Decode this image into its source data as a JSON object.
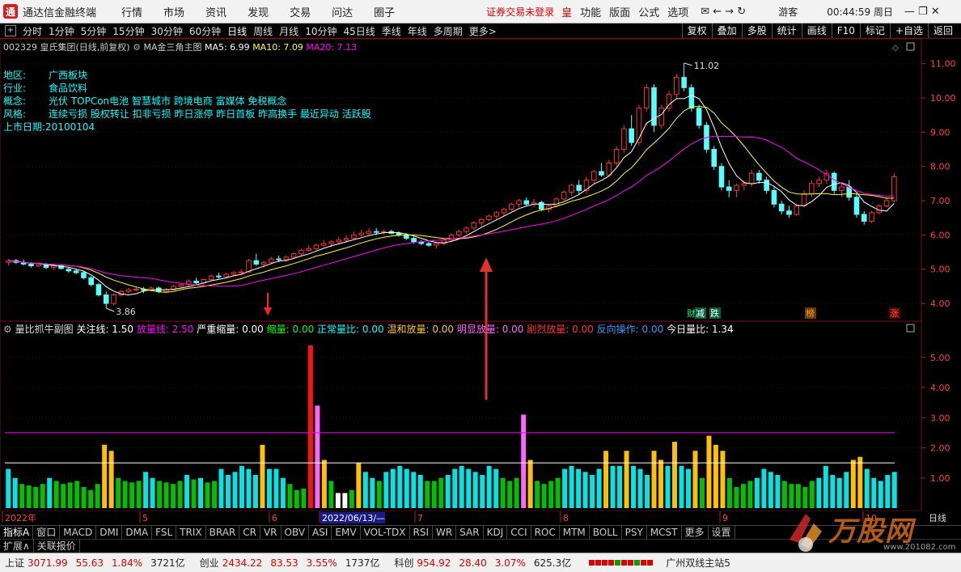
{
  "menubar": {
    "logo": "通",
    "app_title": "通达信金融终端",
    "menus": [
      "行情",
      "市场",
      "资讯",
      "发现",
      "交易",
      "问达",
      "圈子"
    ],
    "warning": "证券交易未登录",
    "right_items": [
      "皇",
      "功能",
      "版面",
      "公式",
      "选项"
    ],
    "tool_icons": "✉ ← → ↻",
    "guest": "游客",
    "clock": "00:44:59 周日",
    "window_buttons": "— ❐ ✕"
  },
  "periodbar": {
    "periods": [
      "分时",
      "1分钟",
      "5分钟",
      "15分钟",
      "30分钟",
      "60分钟",
      "日线",
      "周线",
      "月线",
      "10分钟",
      "45日线",
      "季线",
      "年线",
      "多周期",
      "更多>"
    ],
    "active": "日线",
    "right_buttons": [
      "复权",
      "叠加",
      "多股",
      "统计",
      "画线",
      "F10",
      "标记",
      "+自选",
      "返回"
    ]
  },
  "main_header": {
    "stock": "002329 皇氏集团(日线,前复权)",
    "indicator": "MA金三角主图",
    "ma5": "MA5: 6.99",
    "ma10": "MA10: 7.09",
    "ma20": "MA20: 7.13"
  },
  "info": [
    {
      "key": "地区:",
      "value": "广西板块"
    },
    {
      "key": "行业:",
      "value": "食品饮料"
    },
    {
      "key": "概念:",
      "value": "光伏 TOPCon电池 智慧城市 跨境电商 富媒体 免税概念"
    },
    {
      "key": "风格:",
      "value": "连续亏损 股权转让 扣非亏损 昨日涨停 昨日首板 昨高换手 最近异动 活跃股"
    },
    {
      "key": "上市日期:",
      "value": "20100104"
    }
  ],
  "price_axis": [
    "11.00",
    "10.00",
    "9.00",
    "8.00",
    "7.00",
    "6.00",
    "5.00",
    "4.00"
  ],
  "annotations": {
    "high": "11.02",
    "low": "3.86",
    "badges": [
      "减",
      "跌",
      "榜",
      "涨"
    ],
    "badge_prefix": "财"
  },
  "sub_header": {
    "name": "量比抓牛副图",
    "items": [
      {
        "label": "关注线: 1.50",
        "color": "#ffffff"
      },
      {
        "label": "放量线: 2.50",
        "color": "#ff00ff"
      },
      {
        "label": "严重缩量: 0.00",
        "color": "#ffffff"
      },
      {
        "label": "缩量: 0.00",
        "color": "#00ff00"
      },
      {
        "label": "正常量比: 0.00",
        "color": "#00ffff"
      },
      {
        "label": "温和放量: 0.00",
        "color": "#ffcc00"
      },
      {
        "label": "明显放量: 0.00",
        "color": "#ff66ff"
      },
      {
        "label": "剧烈放量: 0.00",
        "color": "#ff3333"
      },
      {
        "label": "反向操作: 0.00",
        "color": "#3399ff"
      },
      {
        "label": "今日量比: 1.34",
        "color": "#ffffff"
      }
    ]
  },
  "sub_axis": [
    "5.00",
    "4.00",
    "3.00",
    "2.00",
    "1.00"
  ],
  "time_axis": {
    "labels": [
      "2022年",
      "5",
      "6",
      "2022/06/13/—",
      "7",
      "8",
      "9",
      "10"
    ],
    "period": "日线"
  },
  "indicators": [
    "指标A",
    "窗口",
    "MACD",
    "DMI",
    "DMA",
    "FSL",
    "TRIX",
    "BRAR",
    "CR",
    "VR",
    "OBV",
    "ASI",
    "EMV",
    "VOL-TDX",
    "RSI",
    "WR",
    "SAR",
    "KDJ",
    "CCI",
    "ROC",
    "MTM",
    "BOLL",
    "PSY",
    "MCST",
    "更多",
    "设置"
  ],
  "ext_bar": [
    "扩展∧",
    "关联报价"
  ],
  "status": {
    "sh": {
      "name": "上证",
      "price": "3071.99",
      "chg": "55.63",
      "pct": "1.84%",
      "amt": "3721亿"
    },
    "cy": {
      "name": "创业",
      "price": "2434.22",
      "chg": "83.53",
      "pct": "3.55%",
      "amt": "1737亿"
    },
    "kc": {
      "name": "科创",
      "price": "954.92",
      "chg": "28.40",
      "pct": "3.07%",
      "amt": "625.3亿"
    },
    "server": "广州双线主站5"
  },
  "watermark": {
    "text": "万股网",
    "url": "www.201082.com"
  },
  "chart_data": {
    "type": "candlestick",
    "title": "002329 皇氏集团(日线,前复权)",
    "ylim": [
      3.6,
      11.3
    ],
    "price_ticks": [
      4,
      5,
      6,
      7,
      8,
      9,
      10,
      11
    ],
    "ohlc": [
      [
        5.2,
        5.3,
        5.1,
        5.25
      ],
      [
        5.25,
        5.3,
        5.15,
        5.2
      ],
      [
        5.2,
        5.28,
        5.1,
        5.15
      ],
      [
        5.15,
        5.2,
        5.05,
        5.1
      ],
      [
        5.1,
        5.2,
        5.05,
        5.15
      ],
      [
        5.15,
        5.18,
        5.0,
        5.05
      ],
      [
        5.05,
        5.12,
        4.98,
        5.1
      ],
      [
        5.1,
        5.14,
        5.0,
        5.02
      ],
      [
        5.0,
        5.05,
        4.9,
        4.95
      ],
      [
        4.95,
        5.0,
        4.85,
        4.9
      ],
      [
        4.9,
        4.95,
        4.7,
        4.75
      ],
      [
        4.75,
        4.8,
        4.5,
        4.55
      ],
      [
        4.55,
        4.6,
        4.2,
        4.25
      ],
      [
        4.25,
        4.35,
        3.86,
        4.0
      ],
      [
        4.0,
        4.3,
        3.95,
        4.25
      ],
      [
        4.25,
        4.4,
        4.2,
        4.35
      ],
      [
        4.35,
        4.45,
        4.3,
        4.4
      ],
      [
        4.4,
        4.5,
        4.35,
        4.42
      ],
      [
        4.42,
        4.48,
        4.3,
        4.38
      ],
      [
        4.38,
        4.5,
        4.35,
        4.45
      ],
      [
        4.45,
        4.5,
        4.3,
        4.35
      ],
      [
        4.35,
        4.45,
        4.3,
        4.4
      ],
      [
        4.4,
        4.55,
        4.38,
        4.5
      ],
      [
        4.5,
        4.6,
        4.45,
        4.55
      ],
      [
        4.55,
        4.7,
        4.5,
        4.65
      ],
      [
        4.65,
        4.75,
        4.55,
        4.6
      ],
      [
        4.6,
        4.72,
        4.55,
        4.7
      ],
      [
        4.7,
        4.85,
        4.65,
        4.8
      ],
      [
        4.8,
        4.9,
        4.72,
        4.78
      ],
      [
        4.78,
        4.9,
        4.75,
        4.85
      ],
      [
        4.85,
        4.95,
        4.8,
        4.9
      ],
      [
        4.9,
        5.0,
        4.85,
        4.92
      ],
      [
        4.92,
        5.3,
        4.9,
        5.25
      ],
      [
        5.25,
        5.45,
        5.1,
        5.15
      ],
      [
        5.15,
        5.25,
        5.05,
        5.2
      ],
      [
        5.2,
        5.35,
        5.15,
        5.3
      ],
      [
        5.3,
        5.4,
        5.2,
        5.28
      ],
      [
        5.28,
        5.4,
        5.22,
        5.35
      ],
      [
        5.35,
        5.5,
        5.3,
        5.45
      ],
      [
        5.45,
        5.6,
        5.4,
        5.55
      ],
      [
        5.55,
        5.7,
        5.5,
        5.6
      ],
      [
        5.6,
        5.75,
        5.55,
        5.7
      ],
      [
        5.7,
        5.85,
        5.65,
        5.75
      ],
      [
        5.75,
        5.85,
        5.65,
        5.8
      ],
      [
        5.8,
        5.95,
        5.75,
        5.85
      ],
      [
        5.85,
        6.0,
        5.8,
        5.9
      ],
      [
        5.9,
        6.1,
        5.85,
        6.0
      ],
      [
        6.0,
        6.15,
        5.95,
        6.05
      ],
      [
        6.05,
        6.2,
        6.0,
        6.1
      ],
      [
        6.1,
        6.2,
        6.0,
        6.08
      ],
      [
        6.08,
        6.15,
        6.0,
        6.1
      ],
      [
        6.1,
        6.15,
        6.02,
        6.05
      ],
      [
        6.05,
        6.1,
        5.95,
        6.0
      ],
      [
        6.0,
        6.05,
        5.85,
        5.9
      ],
      [
        5.9,
        5.95,
        5.75,
        5.8
      ],
      [
        5.8,
        5.85,
        5.7,
        5.75
      ],
      [
        5.75,
        5.8,
        5.65,
        5.7
      ],
      [
        5.7,
        5.78,
        5.6,
        5.75
      ],
      [
        5.75,
        5.9,
        5.7,
        5.85
      ],
      [
        5.85,
        6.05,
        5.8,
        6.0
      ],
      [
        6.0,
        6.15,
        5.95,
        6.1
      ],
      [
        6.1,
        6.25,
        6.05,
        6.2
      ],
      [
        6.2,
        6.4,
        6.15,
        6.35
      ],
      [
        6.35,
        6.5,
        6.25,
        6.45
      ],
      [
        6.45,
        6.6,
        6.4,
        6.55
      ],
      [
        6.55,
        6.7,
        6.45,
        6.65
      ],
      [
        6.65,
        6.8,
        6.55,
        6.75
      ],
      [
        6.75,
        6.95,
        6.7,
        6.9
      ],
      [
        6.9,
        7.05,
        6.8,
        7.0
      ],
      [
        7.0,
        7.1,
        6.85,
        6.9
      ],
      [
        6.9,
        7.05,
        6.8,
        6.95
      ],
      [
        6.95,
        7.0,
        6.7,
        6.75
      ],
      [
        6.75,
        6.9,
        6.65,
        6.85
      ],
      [
        6.85,
        7.1,
        6.8,
        7.05
      ],
      [
        7.05,
        7.3,
        7.0,
        7.25
      ],
      [
        7.25,
        7.5,
        7.15,
        7.45
      ],
      [
        7.45,
        7.6,
        7.2,
        7.3
      ],
      [
        7.3,
        7.7,
        7.2,
        7.6
      ],
      [
        7.6,
        7.9,
        7.5,
        7.85
      ],
      [
        7.85,
        8.1,
        7.7,
        7.75
      ],
      [
        7.75,
        8.2,
        7.7,
        8.1
      ],
      [
        8.1,
        8.6,
        8.0,
        8.5
      ],
      [
        8.5,
        9.2,
        8.4,
        9.1
      ],
      [
        9.1,
        9.5,
        8.6,
        8.7
      ],
      [
        8.7,
        9.8,
        8.6,
        9.7
      ],
      [
        9.7,
        10.4,
        9.6,
        10.3
      ],
      [
        10.3,
        10.4,
        9.0,
        9.2
      ],
      [
        9.2,
        9.8,
        9.1,
        9.7
      ],
      [
        9.7,
        10.2,
        9.6,
        10.1
      ],
      [
        10.1,
        10.7,
        10.0,
        10.6
      ],
      [
        10.6,
        11.02,
        10.2,
        10.3
      ],
      [
        10.3,
        10.4,
        9.6,
        9.7
      ],
      [
        9.7,
        9.8,
        9.1,
        9.2
      ],
      [
        9.2,
        9.3,
        8.4,
        8.5
      ],
      [
        8.5,
        8.6,
        7.9,
        8.0
      ],
      [
        8.0,
        8.1,
        7.3,
        7.4
      ],
      [
        7.4,
        7.6,
        7.1,
        7.3
      ],
      [
        7.3,
        7.5,
        7.1,
        7.45
      ],
      [
        7.45,
        7.6,
        7.3,
        7.5
      ],
      [
        7.5,
        7.9,
        7.4,
        7.8
      ],
      [
        7.8,
        7.9,
        7.5,
        7.6
      ],
      [
        7.6,
        7.7,
        7.2,
        7.3
      ],
      [
        7.3,
        7.4,
        6.8,
        6.9
      ],
      [
        6.9,
        7.0,
        6.6,
        6.7
      ],
      [
        6.7,
        6.85,
        6.5,
        6.6
      ],
      [
        6.6,
        6.9,
        6.55,
        6.85
      ],
      [
        6.85,
        7.3,
        6.8,
        7.2
      ],
      [
        7.2,
        7.6,
        7.1,
        7.5
      ],
      [
        7.5,
        7.7,
        7.4,
        7.6
      ],
      [
        7.6,
        7.9,
        7.5,
        7.8
      ],
      [
        7.8,
        7.85,
        7.2,
        7.3
      ],
      [
        7.3,
        7.5,
        7.1,
        7.4
      ],
      [
        7.4,
        7.6,
        7.0,
        7.1
      ],
      [
        7.1,
        7.2,
        6.5,
        6.6
      ],
      [
        6.6,
        6.7,
        6.3,
        6.4
      ],
      [
        6.4,
        6.7,
        6.35,
        6.65
      ],
      [
        6.65,
        6.9,
        6.6,
        6.85
      ],
      [
        6.85,
        7.1,
        6.8,
        7.0
      ],
      [
        7.0,
        7.8,
        6.95,
        7.7
      ]
    ],
    "ma_series": [
      {
        "name": "MA5",
        "color": "#ffffff"
      },
      {
        "name": "MA10",
        "color": "#ffff00"
      },
      {
        "name": "MA20",
        "color": "#ff00ff"
      }
    ],
    "volume_ratio": {
      "ylim": [
        0,
        5.8
      ],
      "ticks": [
        1,
        2,
        3,
        4,
        5
      ],
      "lines": [
        {
          "value": 1.5,
          "color": "#ffffff"
        },
        {
          "value": 2.5,
          "color": "#ff00ff"
        }
      ],
      "values": [
        1.3,
        1.0,
        0.8,
        0.75,
        0.7,
        0.8,
        1.0,
        0.9,
        0.8,
        0.85,
        0.9,
        0.7,
        0.6,
        0.8,
        2.1,
        1.9,
        1.0,
        0.9,
        0.85,
        0.9,
        1.2,
        1.0,
        0.9,
        0.85,
        0.8,
        0.9,
        1.1,
        0.95,
        1.0,
        0.85,
        0.9,
        1.3,
        1.1,
        1.2,
        1.4,
        1.3,
        1.1,
        2.1,
        1.3,
        1.3,
        1.0,
        0.8,
        0.6,
        0.65,
        5.4,
        3.4,
        1.6,
        0.9,
        0.5,
        0.5,
        0.6,
        1.5,
        1.2,
        1.0,
        0.9,
        1.2,
        1.3,
        1.4,
        1.3,
        1.2,
        1.1,
        0.9,
        0.9,
        1.0,
        1.1,
        1.3,
        1.4,
        1.3,
        1.2,
        1.1,
        1.4,
        1.3,
        1.0,
        0.9,
        1.0,
        3.1,
        1.6,
        0.9,
        0.8,
        0.9,
        1.0,
        1.3,
        1.4,
        1.3,
        1.2,
        1.1,
        1.3,
        1.9,
        1.4,
        1.4,
        1.9,
        1.4,
        1.3,
        1.1,
        1.9,
        1.6,
        1.4,
        2.2,
        1.4,
        1.3,
        1.9,
        1.0,
        2.4,
        2.1,
        1.9,
        1.0,
        0.7,
        0.8,
        0.9,
        1.0,
        1.3,
        1.2,
        1.1,
        0.9,
        0.8,
        0.8,
        0.7,
        0.9,
        1.0,
        1.4,
        1.1,
        1.0,
        1.2,
        1.6,
        1.7,
        1.3,
        1.0,
        0.9,
        1.1,
        1.2
      ],
      "colors": [
        "#00e5e5",
        "#00e5e5",
        "#00c000",
        "#00c000",
        "#00c000",
        "#00c000",
        "#00e5e5",
        "#00c000",
        "#00c000",
        "#00c000",
        "#00c000",
        "#00c000",
        "#00c000",
        "#00c000",
        "#ffc000",
        "#ffc000",
        "#00c000",
        "#00c000",
        "#00c000",
        "#00c000",
        "#00e5e5",
        "#00e5e5",
        "#00c000",
        "#00c000",
        "#00c000",
        "#00c000",
        "#00e5e5",
        "#00c000",
        "#00e5e5",
        "#00c000",
        "#00c000",
        "#00e5e5",
        "#00e5e5",
        "#00e5e5",
        "#00e5e5",
        "#00e5e5",
        "#00e5e5",
        "#ffc000",
        "#00e5e5",
        "#00e5e5",
        "#00e5e5",
        "#00c000",
        "#00c000",
        "#00c000",
        "#ff1010",
        "#ff66ff",
        "#ffc000",
        "#00c000",
        "#ffffff",
        "#ffffff",
        "#00c000",
        "#ffc000",
        "#00e5e5",
        "#00e5e5",
        "#00c000",
        "#00e5e5",
        "#00e5e5",
        "#00e5e5",
        "#00e5e5",
        "#00e5e5",
        "#00e5e5",
        "#00c000",
        "#00c000",
        "#00c000",
        "#00e5e5",
        "#00e5e5",
        "#00e5e5",
        "#00e5e5",
        "#00e5e5",
        "#00e5e5",
        "#00e5e5",
        "#00e5e5",
        "#00c000",
        "#00c000",
        "#00c000",
        "#ff66ff",
        "#ffc000",
        "#00c000",
        "#00c000",
        "#00c000",
        "#00c000",
        "#00e5e5",
        "#00e5e5",
        "#00e5e5",
        "#00e5e5",
        "#00e5e5",
        "#00e5e5",
        "#ffc000",
        "#00e5e5",
        "#00e5e5",
        "#ffc000",
        "#00e5e5",
        "#00e5e5",
        "#00e5e5",
        "#ffc000",
        "#ffc000",
        "#00e5e5",
        "#ffc000",
        "#00e5e5",
        "#00e5e5",
        "#ffc000",
        "#00c000",
        "#ffc000",
        "#ffc000",
        "#ffc000",
        "#00c000",
        "#00c000",
        "#00c000",
        "#00c000",
        "#00e5e5",
        "#00e5e5",
        "#00e5e5",
        "#00e5e5",
        "#00c000",
        "#00c000",
        "#00c000",
        "#00c000",
        "#00c000",
        "#00e5e5",
        "#00e5e5",
        "#00e5e5",
        "#00e5e5",
        "#00e5e5",
        "#ffc000",
        "#ffc000",
        "#00e5e5",
        "#00e5e5",
        "#00e5e5",
        "#00e5e5",
        "#00e5e5"
      ]
    }
  }
}
